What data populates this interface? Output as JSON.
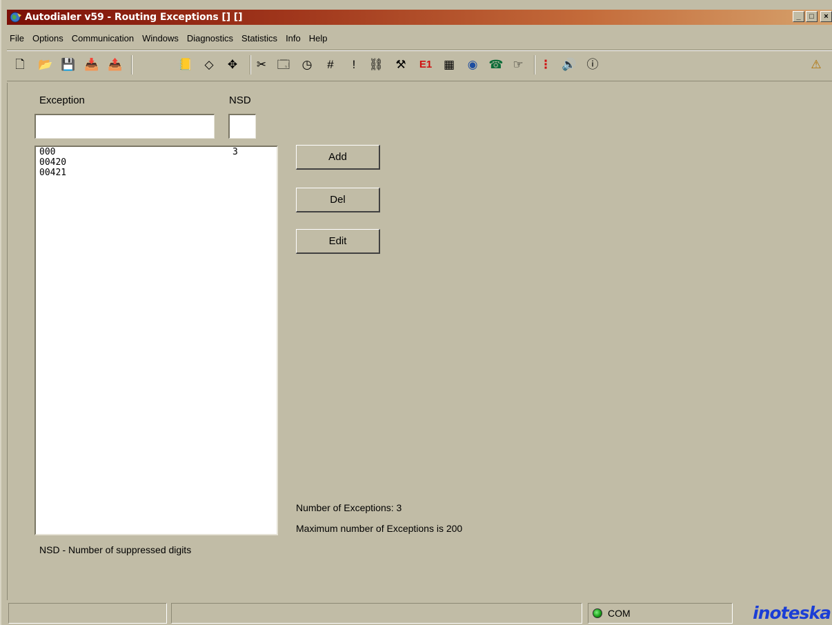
{
  "window": {
    "title": "Autodialer v59 - Routing Exceptions [] []",
    "minimize": "_",
    "maximize": "□",
    "close": "×"
  },
  "menu": [
    "File",
    "Options",
    "Communication",
    "Windows",
    "Diagnostics",
    "Statistics",
    "Info",
    "Help"
  ],
  "toolbar": {
    "buttons": [
      {
        "name": "new-icon",
        "glyph": "🗋"
      },
      {
        "name": "open-icon",
        "glyph": "📂"
      },
      {
        "name": "save-icon",
        "glyph": "💾"
      },
      {
        "name": "import-icon",
        "glyph": "📥"
      },
      {
        "name": "export-icon",
        "glyph": "📤"
      },
      {
        "name": "phone-book-icon",
        "glyph": "📒"
      },
      {
        "name": "chip-icon",
        "glyph": "◇"
      },
      {
        "name": "routing-icon",
        "glyph": "✥"
      },
      {
        "name": "scissors-icon",
        "glyph": "✂"
      },
      {
        "name": "card-icon",
        "glyph": "🗔"
      },
      {
        "name": "timer-icon",
        "glyph": "◷"
      },
      {
        "name": "hash-icon",
        "glyph": "#"
      },
      {
        "name": "alert-icon",
        "glyph": "!"
      },
      {
        "name": "link-icon",
        "glyph": "⛓"
      },
      {
        "name": "tools-icon",
        "glyph": "⚒"
      },
      {
        "name": "e1-icon",
        "glyph": "E1"
      },
      {
        "name": "calendar-icon",
        "glyph": "▦"
      },
      {
        "name": "globe-icon",
        "glyph": "◉"
      },
      {
        "name": "cli-phone-icon",
        "glyph": "☎"
      },
      {
        "name": "hand-icon",
        "glyph": "☞"
      },
      {
        "name": "traffic-light-icon",
        "glyph": "⋮"
      },
      {
        "name": "speaker-icon",
        "glyph": "🔊"
      },
      {
        "name": "info-icon",
        "glyph": "ⓘ"
      },
      {
        "name": "help-person-icon",
        "glyph": "⚠"
      }
    ]
  },
  "form": {
    "exception_label": "Exception",
    "nsd_label": "NSD",
    "exception_value": "",
    "nsd_value": "",
    "rows": [
      {
        "exception": "000",
        "nsd": "3"
      },
      {
        "exception": "00420",
        "nsd": ""
      },
      {
        "exception": "00421",
        "nsd": ""
      }
    ],
    "add_label": "Add",
    "del_label": "Del",
    "edit_label": "Edit",
    "count_text": "Number of Exceptions:  3",
    "max_text": "Maximum number of Exceptions is   200",
    "nsd_note": "NSD - Number of suppressed digits"
  },
  "statusbar": {
    "com_label": "COM",
    "brand": "inoteska"
  },
  "colors": {
    "title_start": "#7b1008",
    "face": "#c1bca6",
    "brand": "#1b3ed6"
  }
}
